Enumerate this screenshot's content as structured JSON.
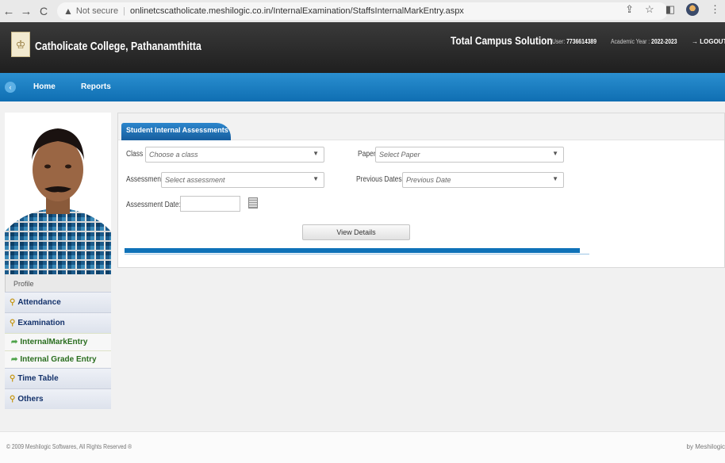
{
  "browser": {
    "security_label": "Not secure",
    "url": "onlinetcscatholicate.meshilogic.co.in/InternalExamination/StaffsInternalMarkEntry.aspx"
  },
  "header": {
    "college_name": "Catholicate College, Pathanamthitta",
    "product_name": "Total Campus Solution",
    "user_label": "User:",
    "user_id": "7736614389",
    "year_label": "Academic Year :",
    "year_value": "2022-2023",
    "logout": "LOGOUT"
  },
  "menu": {
    "items": [
      "Home",
      "Reports"
    ]
  },
  "sidebar": {
    "profile_label": "Profile",
    "items": [
      {
        "label": "Attendance",
        "type": "section"
      },
      {
        "label": "Examination",
        "type": "section"
      },
      {
        "label": "InternalMarkEntry",
        "type": "sub"
      },
      {
        "label": "Internal Grade Entry",
        "type": "sub"
      },
      {
        "label": "Time Table",
        "type": "section"
      },
      {
        "label": "Others",
        "type": "section"
      }
    ]
  },
  "panel": {
    "tab_title": "Student Internal Assessments",
    "class_label": "Class :",
    "class_placeholder": "Choose a class",
    "paper_label": "Paper",
    "paper_placeholder": "Select Paper",
    "assessment_label": "Assessment",
    "assessment_placeholder": "Select assessment",
    "previous_dates_label": "Previous Dates",
    "previous_dates_placeholder": "Previous Date",
    "assessment_date_label": "Assessment Date:",
    "assessment_date_value": "",
    "view_button": "View Details",
    "progress_fraction": 0.98
  },
  "footer": {
    "copyright": "© 2009 Meshilogic Softwares, All Rights Reserved ®",
    "by": "by Meshilogic"
  },
  "colors": {
    "header_bg": "#2b2b2b",
    "menu_bg": "#1679bd",
    "progress": "#0f72b8",
    "sidebar_text": "#14326b",
    "sub_text": "#2a6e1f"
  }
}
